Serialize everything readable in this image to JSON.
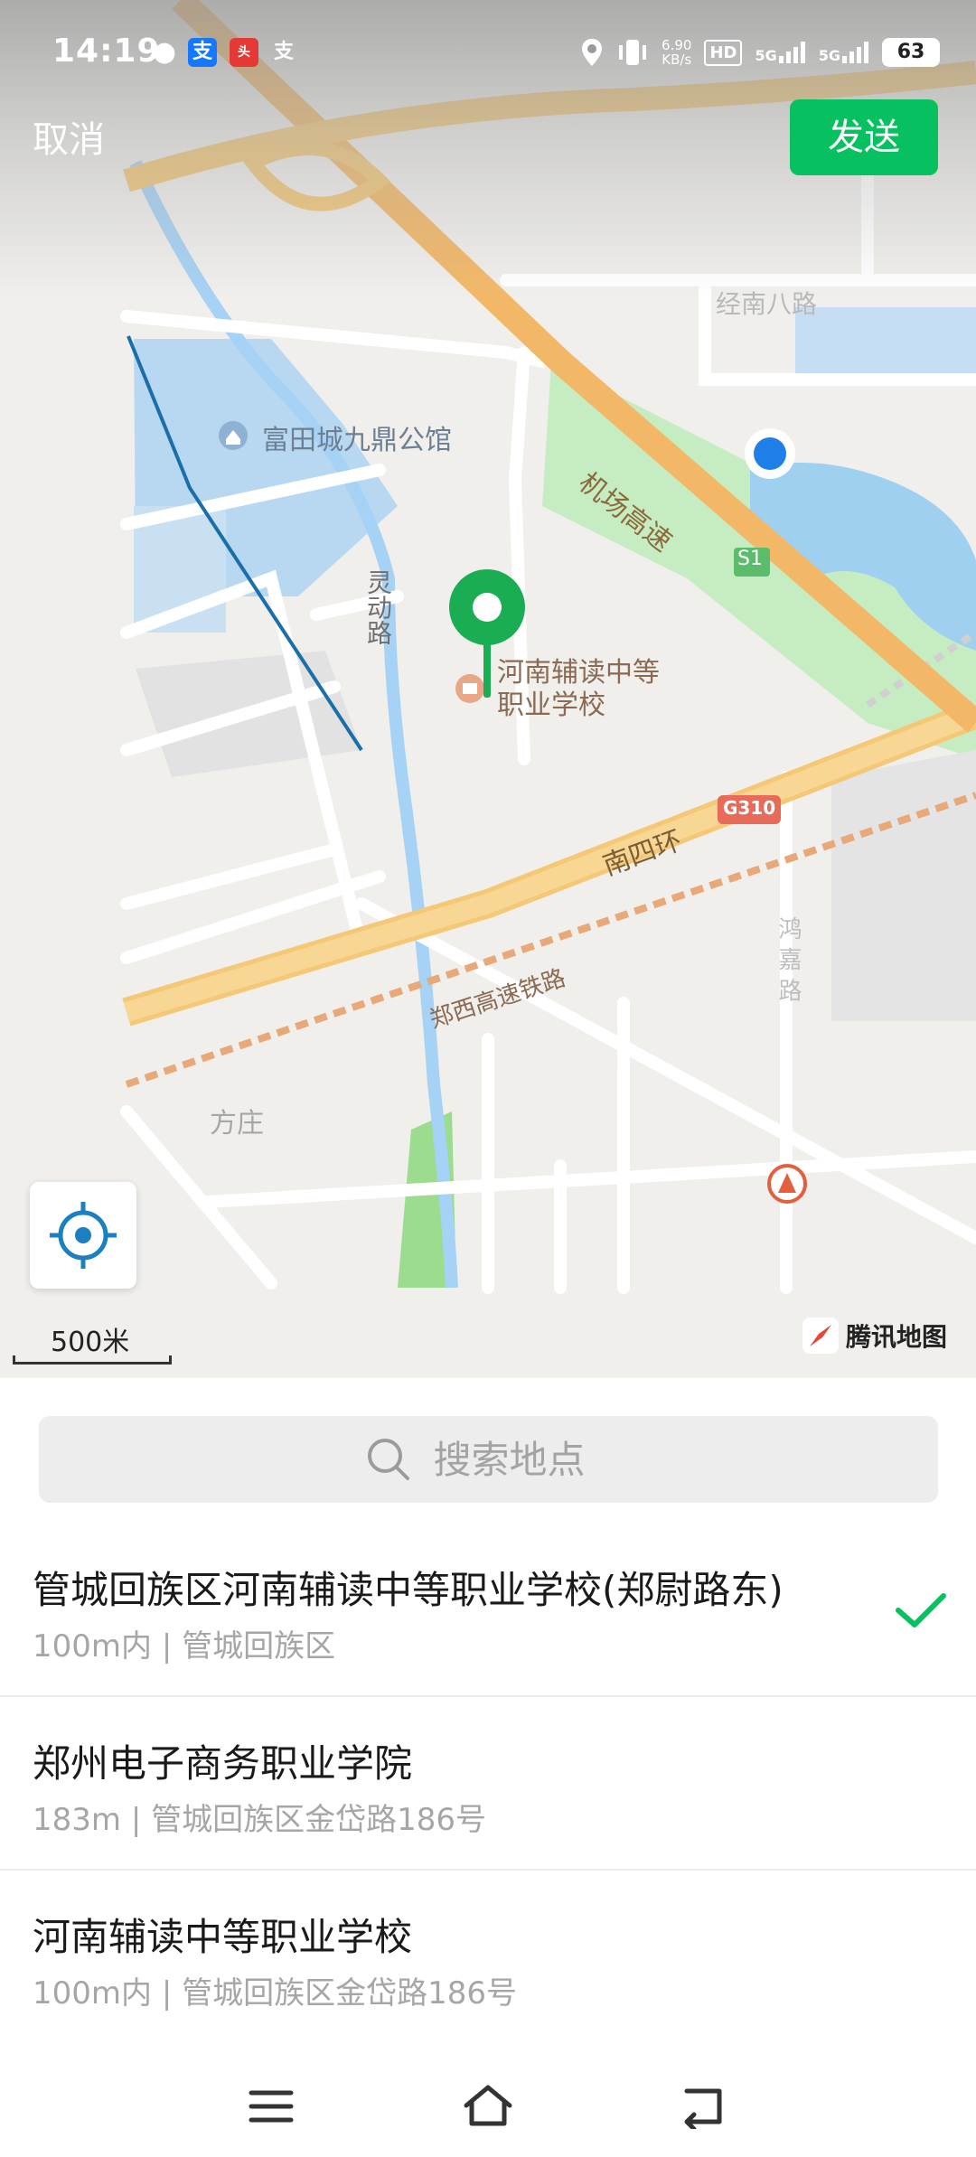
{
  "status_bar": {
    "time": "14:19",
    "net_speed_value": "6.90",
    "net_speed_unit": "KB/s",
    "hd_label": "HD",
    "signal_1": "5G",
    "signal_2": "5G",
    "battery": "63"
  },
  "header": {
    "cancel_label": "取消",
    "send_label": "发送"
  },
  "map": {
    "labels": {
      "jingnan": "经南八路",
      "fudian": "富田城九鼎公馆",
      "airport_expressway": "机场高速",
      "s1": "S1",
      "lingdong": "灵动路",
      "poi_line1": "河南辅读中等",
      "poi_line2": "职业学校",
      "g310": "G310",
      "nansihuan": "南四环",
      "zhengxi_rail": "郑西高速铁路",
      "hong_road": "鸿 嘉 路",
      "fangzhuang": "方庄"
    },
    "scale_label": "500米",
    "brand": "腾讯地图",
    "colors": {
      "accent_green": "#07c160",
      "marker_green": "#1aad54",
      "location_blue": "#1e7fe8",
      "highway_orange": "#f5c877",
      "water": "#b8d8f2",
      "park": "#c6edc2"
    }
  },
  "search": {
    "placeholder": "搜索地点"
  },
  "results": [
    {
      "title": "管城回族区河南辅读中等职业学校(郑尉路东)",
      "subtitle": "100m内 | 管城回族区",
      "selected": true
    },
    {
      "title": "郑州电子商务职业学院",
      "subtitle": "183m | 管城回族区金岱路186号",
      "selected": false
    },
    {
      "title": "河南辅读中等职业学校",
      "subtitle": "100m内 | 管城回族区金岱路186号",
      "selected": false
    }
  ]
}
